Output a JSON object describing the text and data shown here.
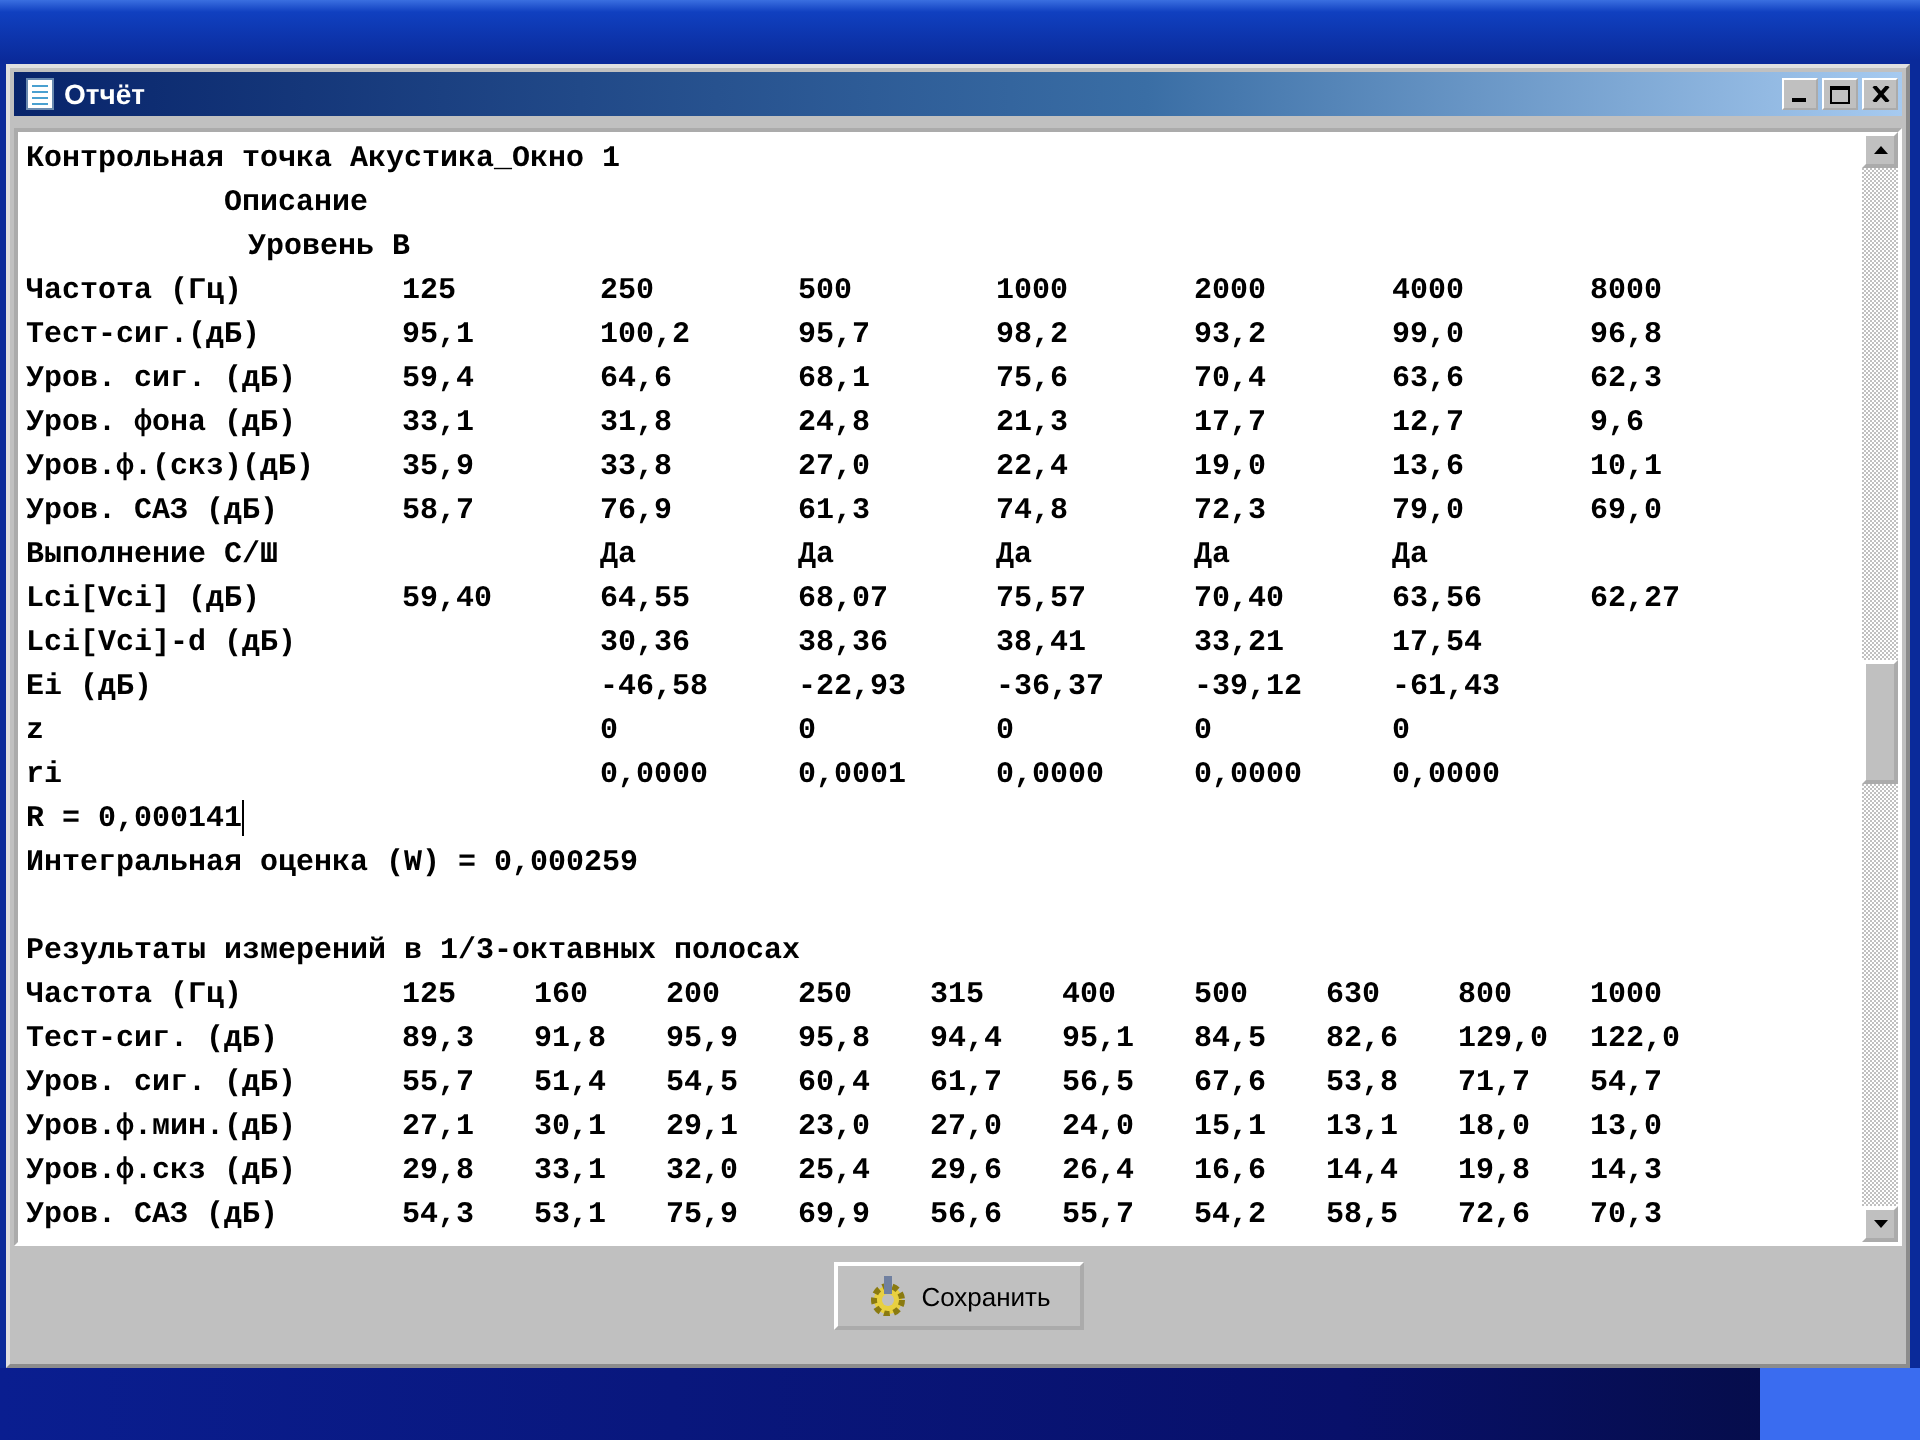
{
  "window": {
    "title": "Отчёт"
  },
  "report": {
    "title": "Контрольная точка Акустика_Окно 1",
    "subtitles": [
      "Описание",
      "Уровень В"
    ],
    "octave_table": {
      "rows": [
        {
          "kind": "full",
          "label": "Частота (Гц)",
          "values": [
            "125",
            "250",
            "500",
            "1000",
            "2000",
            "4000",
            "8000"
          ]
        },
        {
          "kind": "full",
          "label": "Тест-сиг.(дБ)",
          "values": [
            "95,1",
            "100,2",
            "95,7",
            "98,2",
            "93,2",
            "99,0",
            "96,8"
          ]
        },
        {
          "kind": "full",
          "label": "Уров. сиг. (дБ)",
          "values": [
            "59,4",
            "64,6",
            "68,1",
            "75,6",
            "70,4",
            "63,6",
            "62,3"
          ]
        },
        {
          "kind": "full",
          "label": "Уров. фона (дБ)",
          "values": [
            "33,1",
            "31,8",
            "24,8",
            "21,3",
            "17,7",
            "12,7",
            "9,6"
          ]
        },
        {
          "kind": "full",
          "label": "Уров.ф.(скз)(дБ)",
          "values": [
            "35,9",
            "33,8",
            "27,0",
            "22,4",
            "19,0",
            "13,6",
            "10,1"
          ]
        },
        {
          "kind": "full",
          "label": "Уров. САЗ (дБ)",
          "values": [
            "58,7",
            "76,9",
            "61,3",
            "74,8",
            "72,3",
            "79,0",
            "69,0"
          ]
        },
        {
          "kind": "shifted",
          "label": "Выполнение С/Ш",
          "values": [
            "Да",
            "Да",
            "Да",
            "Да",
            "Да"
          ]
        },
        {
          "kind": "full",
          "label": "Lci[Vci] (дБ)",
          "values": [
            "59,40",
            "64,55",
            "68,07",
            "75,57",
            "70,40",
            "63,56",
            "62,27"
          ]
        },
        {
          "kind": "shifted",
          "label": "Lci[Vci]-d (дБ)",
          "values": [
            "30,36",
            "38,36",
            "38,41",
            "33,21",
            "17,54"
          ]
        },
        {
          "kind": "shifted",
          "label": "Ei (дБ)",
          "values": [
            "-46,58",
            "-22,93",
            "-36,37",
            "-39,12",
            "-61,43"
          ]
        },
        {
          "kind": "shifted",
          "label": "z",
          "values": [
            "0",
            "0",
            "0",
            "0",
            "0"
          ]
        },
        {
          "kind": "shifted",
          "label": "ri",
          "values": [
            "0,0000",
            "0,0001",
            "0,0000",
            "0,0000",
            "0,0000"
          ]
        }
      ]
    },
    "summary": [
      "R = 0,000141",
      "Интегральная оценка (W) = 0,000259"
    ],
    "third_octave_title": "Результаты измерений в 1/3-октавных полосах",
    "third_octave_table": {
      "rows": [
        {
          "kind": "full",
          "label": "Частота (Гц)",
          "values": [
            "125",
            "160",
            "200",
            "250",
            "315",
            "400",
            "500",
            "630",
            "800",
            "1000"
          ]
        },
        {
          "kind": "full",
          "label": "Тест-сиг. (дБ)",
          "values": [
            "89,3",
            "91,8",
            "95,9",
            "95,8",
            "94,4",
            "95,1",
            "84,5",
            "82,6",
            "129,0",
            "122,0"
          ]
        },
        {
          "kind": "full",
          "label": "Уров. сиг. (дБ)",
          "values": [
            "55,7",
            "51,4",
            "54,5",
            "60,4",
            "61,7",
            "56,5",
            "67,6",
            "53,8",
            "71,7",
            "54,7"
          ]
        },
        {
          "kind": "full",
          "label": "Уров.ф.мин.(дБ)",
          "values": [
            "27,1",
            "30,1",
            "29,1",
            "23,0",
            "27,0",
            "24,0",
            "15,1",
            "13,1",
            "18,0",
            "13,0"
          ]
        },
        {
          "kind": "full",
          "label": "Уров.ф.скз (дБ)",
          "values": [
            "29,8",
            "33,1",
            "32,0",
            "25,4",
            "29,6",
            "26,4",
            "16,6",
            "14,4",
            "19,8",
            "14,3"
          ]
        },
        {
          "kind": "full",
          "label": "Уров. САЗ (дБ)",
          "values": [
            "54,3",
            "53,1",
            "75,9",
            "69,9",
            "56,6",
            "55,7",
            "54,2",
            "58,5",
            "72,6",
            "70,3"
          ]
        }
      ]
    }
  },
  "buttons": [
    {
      "label": "Сохранить"
    }
  ]
}
